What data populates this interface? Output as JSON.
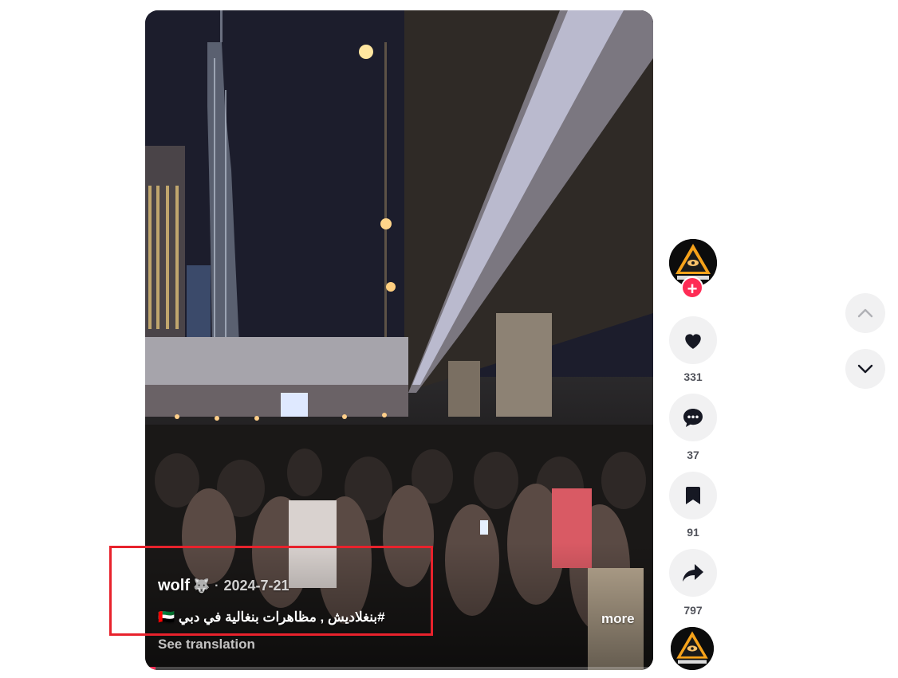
{
  "video": {
    "author": "wolf",
    "author_emoji": "🐺",
    "separator": "·",
    "date": "2024-7-21",
    "caption": "#بنغلاديش , مظاهرات بنغالية في دبي 🇦🇪",
    "more_label": "more",
    "see_translation_label": "See translation",
    "progress": 0.02
  },
  "actions": {
    "likes": "331",
    "comments": "37",
    "bookmarks": "91",
    "shares": "797"
  },
  "colors": {
    "accent": "#fe2c55",
    "highlight_box": "#e8222c",
    "action_bg": "#f1f1f2"
  },
  "icons": [
    "plus-icon",
    "heart-icon",
    "comment-icon",
    "bookmark-icon",
    "share-icon",
    "chevron-up-icon",
    "chevron-down-icon"
  ]
}
